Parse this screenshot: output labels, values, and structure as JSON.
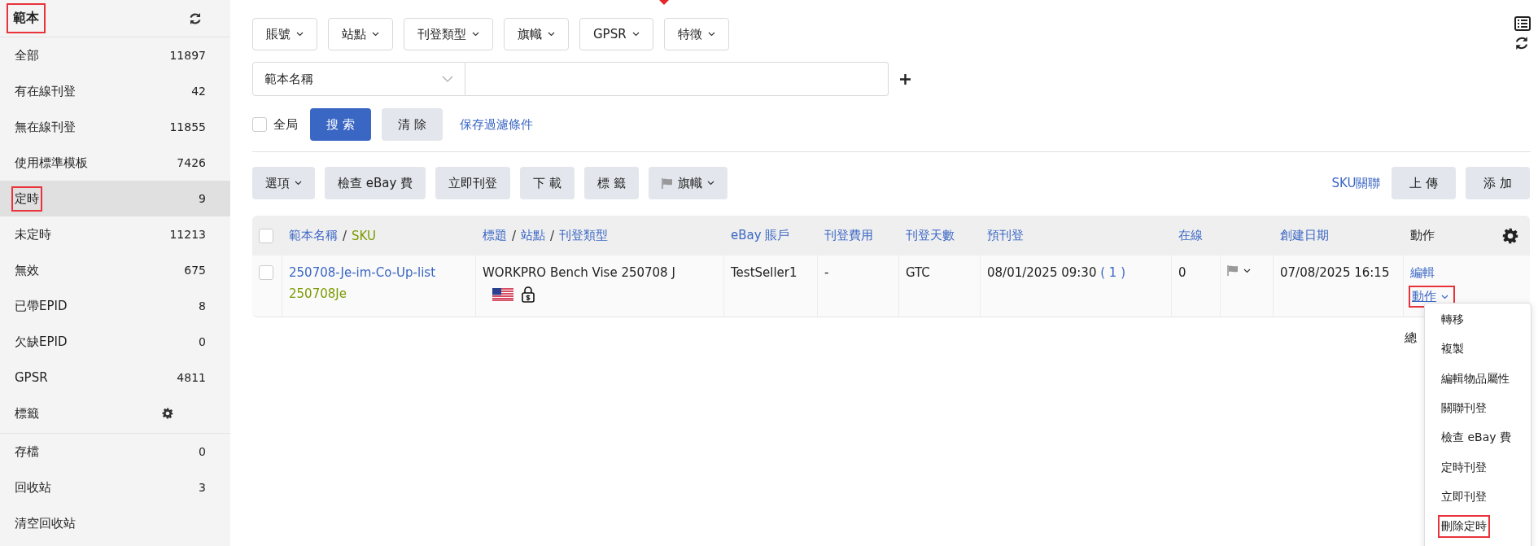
{
  "sidebar": {
    "title": "範本",
    "title_highlighted": true,
    "items": [
      {
        "label": "全部",
        "count": "11897",
        "selected": false,
        "highlighted": false,
        "kind": "count"
      },
      {
        "label": "有在線刊登",
        "count": "42",
        "selected": false,
        "highlighted": false,
        "kind": "count"
      },
      {
        "label": "無在線刊登",
        "count": "11855",
        "selected": false,
        "highlighted": false,
        "kind": "count"
      },
      {
        "label": "使用標準模板",
        "count": "7426",
        "selected": false,
        "highlighted": false,
        "kind": "count"
      },
      {
        "label": "定時",
        "count": "9",
        "selected": true,
        "highlighted": true,
        "kind": "count"
      },
      {
        "label": "未定時",
        "count": "11213",
        "selected": false,
        "highlighted": false,
        "kind": "count"
      },
      {
        "label": "無效",
        "count": "675",
        "selected": false,
        "highlighted": false,
        "kind": "count"
      },
      {
        "label": "已帶EPID",
        "count": "8",
        "selected": false,
        "highlighted": false,
        "kind": "count"
      },
      {
        "label": "欠缺EPID",
        "count": "0",
        "selected": false,
        "highlighted": false,
        "kind": "count"
      },
      {
        "label": "GPSR",
        "count": "4811",
        "selected": false,
        "highlighted": false,
        "kind": "count"
      },
      {
        "label": "標籤",
        "selected": false,
        "highlighted": false,
        "kind": "settings"
      }
    ],
    "archive_items": [
      {
        "label": "存檔",
        "count": "0",
        "selected": false
      },
      {
        "label": "回收站",
        "count": "3",
        "selected": false
      },
      {
        "label": "清空回收站",
        "selected": false
      }
    ]
  },
  "filters": [
    "賬號",
    "站點",
    "刊登類型",
    "旗幟",
    "GPSR",
    "特徵"
  ],
  "search": {
    "field_select": "範本名稱",
    "global_checkbox": {
      "label": "全局",
      "checked": false
    },
    "search_button": "搜 索",
    "clear_button": "清 除",
    "save_link": "保存過濾條件"
  },
  "toolbar": {
    "buttons": [
      {
        "label": "選項",
        "kind": "dropdown"
      },
      {
        "label": "檢查 eBay 費",
        "kind": "plain"
      },
      {
        "label": "立即刊登",
        "kind": "plain"
      },
      {
        "label": "下 載",
        "kind": "plain"
      },
      {
        "label": "標 籤",
        "kind": "plain"
      },
      {
        "label": "旗幟",
        "kind": "flag-dropdown"
      }
    ],
    "link": "SKU關聯",
    "right_buttons": [
      "上 傳",
      "添 加"
    ]
  },
  "table": {
    "header_checked": false,
    "columns": [
      {
        "parts": [
          {
            "text": "範本名稱",
            "kind": "link"
          },
          {
            "text": "/",
            "kind": "sep"
          },
          {
            "text": "SKU",
            "kind": "sku"
          }
        ]
      },
      {
        "parts": [
          {
            "text": "標題",
            "kind": "link"
          },
          {
            "text": "/",
            "kind": "sep"
          },
          {
            "text": "站點",
            "kind": "link"
          },
          {
            "text": "/",
            "kind": "sep"
          },
          {
            "text": "刊登類型",
            "kind": "link"
          }
        ]
      },
      {
        "parts": [
          {
            "text": "eBay 賬戶",
            "kind": "link"
          }
        ]
      },
      {
        "parts": [
          {
            "text": "刊登費用",
            "kind": "link"
          }
        ]
      },
      {
        "parts": [
          {
            "text": "刊登天數",
            "kind": "link"
          }
        ]
      },
      {
        "parts": [
          {
            "text": "預刊登",
            "kind": "link"
          }
        ]
      },
      {
        "parts": [
          {
            "text": "在線",
            "kind": "link"
          }
        ]
      },
      {
        "parts": [
          {
            "text": "創建日期",
            "kind": "link"
          }
        ]
      },
      {
        "parts": [
          {
            "text": "動作",
            "kind": "plain"
          }
        ]
      }
    ],
    "rows": [
      {
        "checked": false,
        "name": "250708-Je-im-Co-Up-list",
        "sku": "250708Je",
        "title": "WORKPRO Bench Vise 250708 J",
        "account": "TestSeller1",
        "fee": "-",
        "days": "GTC",
        "pre_listing": "08/01/2025 09:30",
        "pre_count": "( 1 )",
        "online": "0",
        "created": "07/08/2025 16:15",
        "edit": "編輯",
        "action": "動作",
        "action_highlighted": true
      }
    ]
  },
  "partial_text": "總",
  "action_menu": [
    {
      "label": "轉移",
      "highlighted": false
    },
    {
      "label": "複製",
      "highlighted": false
    },
    {
      "label": "編輯物品屬性",
      "highlighted": false
    },
    {
      "label": "關聯刊登",
      "highlighted": false
    },
    {
      "label": "檢查 eBay 費",
      "highlighted": false
    },
    {
      "label": "定時刊登",
      "highlighted": false
    },
    {
      "label": "立即刊登",
      "highlighted": false
    },
    {
      "label": "刪除定時",
      "highlighted": true
    }
  ]
}
